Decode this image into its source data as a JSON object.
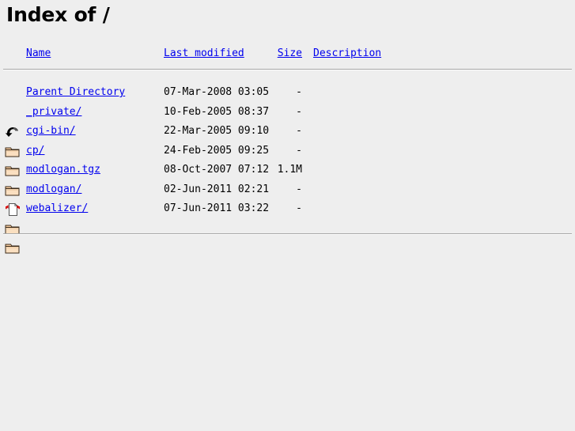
{
  "page": {
    "title": "Index of /",
    "background_color": "#eeeeee",
    "link_color": "#0000ee",
    "text_color": "#000000"
  },
  "table": {
    "headers": {
      "name": "Name",
      "last_modified": "Last modified",
      "size": "Size",
      "description": "Description"
    },
    "rows": [
      {
        "icon": "back-icon",
        "name": "Parent Directory",
        "last_modified": "07-Mar-2008 03:05",
        "size": "-",
        "description": ""
      },
      {
        "icon": "folder-icon",
        "name": "_private/",
        "last_modified": "10-Feb-2005 08:37",
        "size": "-",
        "description": ""
      },
      {
        "icon": "folder-icon",
        "name": "cgi-bin/",
        "last_modified": "22-Mar-2005 09:10",
        "size": "-",
        "description": ""
      },
      {
        "icon": "folder-icon",
        "name": "cp/",
        "last_modified": "24-Feb-2005 09:25",
        "size": "-",
        "description": ""
      },
      {
        "icon": "compressed-icon",
        "name": "modlogan.tgz",
        "last_modified": "08-Oct-2007 07:12",
        "size": "1.1M",
        "description": ""
      },
      {
        "icon": "folder-icon",
        "name": "modlogan/",
        "last_modified": "02-Jun-2011 02:21",
        "size": "-",
        "description": ""
      },
      {
        "icon": "folder-icon",
        "name": "webalizer/",
        "last_modified": "07-Jun-2011 03:22",
        "size": "-",
        "description": ""
      }
    ]
  }
}
